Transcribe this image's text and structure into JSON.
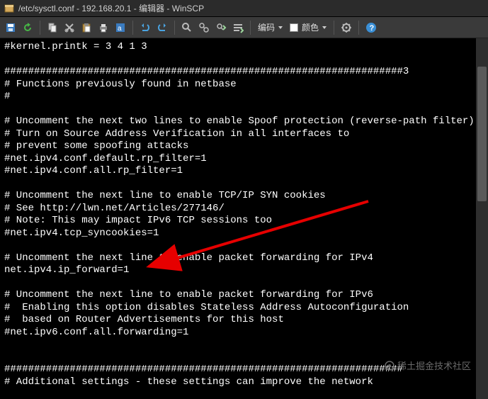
{
  "title": "/etc/sysctl.conf - 192.168.20.1 - 编辑器 - WinSCP",
  "toolbar": {
    "encoding_label": "编码",
    "color_label": "颜色"
  },
  "editor_lines": [
    "#kernel.printk = 3 4 1 3",
    "",
    "###################################################################3",
    "# Functions previously found in netbase",
    "#",
    "",
    "# Uncomment the next two lines to enable Spoof protection (reverse-path filter)",
    "# Turn on Source Address Verification in all interfaces to",
    "# prevent some spoofing attacks",
    "#net.ipv4.conf.default.rp_filter=1",
    "#net.ipv4.conf.all.rp_filter=1",
    "",
    "# Uncomment the next line to enable TCP/IP SYN cookies",
    "# See http://lwn.net/Articles/277146/",
    "# Note: This may impact IPv6 TCP sessions too",
    "#net.ipv4.tcp_syncookies=1",
    "",
    "# Uncomment the next line to enable packet forwarding for IPv4",
    "net.ipv4.ip_forward=1",
    "",
    "# Uncomment the next line to enable packet forwarding for IPv6",
    "#  Enabling this option disables Stateless Address Autoconfiguration",
    "#  based on Router Advertisements for this host",
    "#net.ipv6.conf.all.forwarding=1",
    "",
    "",
    "###################################################################",
    "# Additional settings - these settings can improve the network"
  ],
  "watermark": "稀土掘金技术社区"
}
